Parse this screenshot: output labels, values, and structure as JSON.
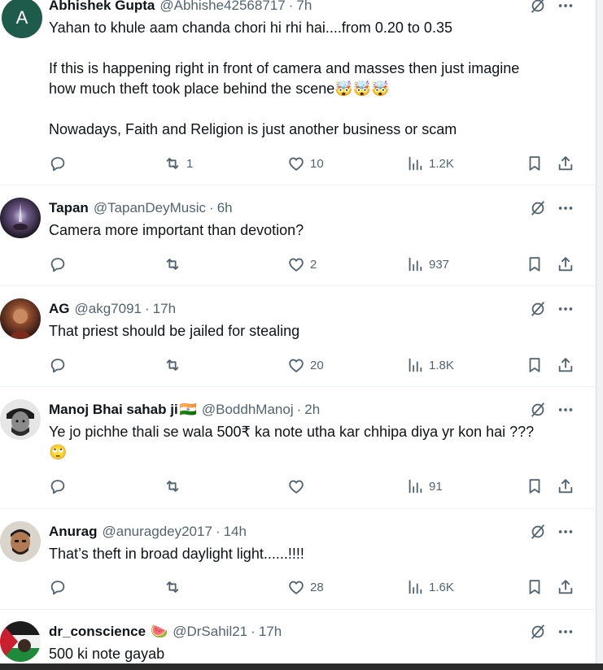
{
  "tweets": [
    {
      "name": "Abhishek Gupta",
      "handle": "@Abhishe42568717",
      "time": "7h",
      "avatar_letter": "A",
      "avatar_color": "#1f5b4a",
      "lines": [
        "Yahan to khule aam chanda chori hi rhi hai....from 0.20 to 0.35",
        "",
        "If this is happening right in front of camera and masses then just imagine",
        "how much theft took place behind the scene🤯🤯🤯",
        "",
        "Nowadays, Faith and Religion is just another business or scam"
      ],
      "stats": {
        "replies": "",
        "reposts": "1",
        "likes": "10",
        "views": "1.2K"
      }
    },
    {
      "name": "Tapan",
      "handle": "@TapanDeyMusic",
      "time": "6h",
      "lines": [
        "Camera more important than devotion?"
      ],
      "stats": {
        "replies": "",
        "reposts": "",
        "likes": "2",
        "views": "937"
      }
    },
    {
      "name": "AG",
      "handle": "@akg7091",
      "time": "17h",
      "lines": [
        "That priest should be jailed for stealing"
      ],
      "stats": {
        "replies": "",
        "reposts": "",
        "likes": "20",
        "views": "1.8K"
      }
    },
    {
      "name": "Manoj Bhai sahab ji",
      "name_emoji": "🇮🇳",
      "handle": "@BoddhManoj",
      "time": "2h",
      "lines": [
        "Ye jo pichhe thali se  wala 500₹ ka note utha kar chhipa diya yr kon hai ???",
        "🙄"
      ],
      "stats": {
        "replies": "",
        "reposts": "",
        "likes": "",
        "views": "91"
      }
    },
    {
      "name": "Anurag",
      "handle": "@anuragdey2017",
      "time": "14h",
      "lines": [
        "That’s theft in broad daylight light......!!!!"
      ],
      "stats": {
        "replies": "",
        "reposts": "",
        "likes": "28",
        "views": "1.6K"
      }
    },
    {
      "name": "dr_conscience",
      "name_emoji": "🍉",
      "handle": "@DrSahil21",
      "time": "17h",
      "lines": [
        "500 ki note gayab"
      ],
      "stats": {
        "replies": "",
        "reposts": "",
        "likes": "",
        "views": ""
      }
    }
  ],
  "icons": {
    "reply": "reply-icon",
    "repost": "repost-icon",
    "like": "heart-icon",
    "views": "views-icon",
    "bookmark": "bookmark-icon",
    "share": "share-icon",
    "grok": "grok-icon",
    "more": "more-icon"
  },
  "colors": {
    "text": "#0f1419",
    "secondary": "#536471",
    "divider": "#eff3f4"
  }
}
